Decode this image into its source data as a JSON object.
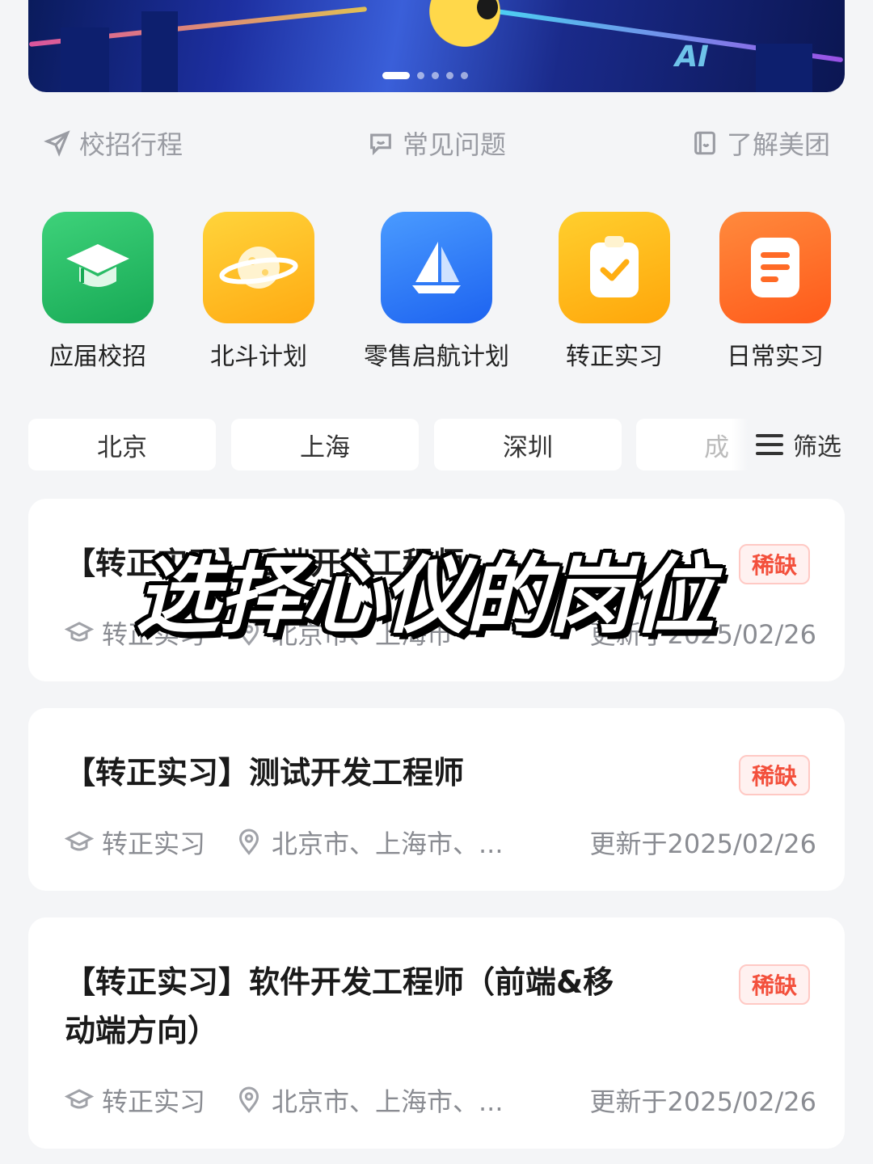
{
  "quick_links": [
    {
      "label": "校招行程",
      "icon": "send-icon"
    },
    {
      "label": "常见问题",
      "icon": "chat-icon"
    },
    {
      "label": "了解美团",
      "icon": "book-icon"
    }
  ],
  "categories": [
    {
      "label": "应届校招",
      "icon": "graduation-cap-icon",
      "color": "#22b862"
    },
    {
      "label": "北斗计划",
      "icon": "planet-icon",
      "color": "#ffbb1f"
    },
    {
      "label": "零售启航计划",
      "icon": "sailboat-icon",
      "color": "#2c76f5"
    },
    {
      "label": "转正实习",
      "icon": "clipboard-check-icon",
      "color": "#ffb81a"
    },
    {
      "label": "日常实习",
      "icon": "document-icon",
      "color": "#ff6a26"
    }
  ],
  "city_tabs": [
    "北京",
    "上海",
    "深圳",
    "成"
  ],
  "filter": {
    "label": "筛选",
    "icon": "menu-icon"
  },
  "overlay_caption": "选择心仪的岗位",
  "jobs": [
    {
      "title": "【转正实习】后端开发工程师",
      "badge": "稀缺",
      "type": "转正实习",
      "locations": "北京市、上海市",
      "updated": "更新于2025/02/26"
    },
    {
      "title": "【转正实习】测试开发工程师",
      "badge": "稀缺",
      "type": "转正实习",
      "locations": "北京市、上海市、...",
      "updated": "更新于2025/02/26"
    },
    {
      "title": "【转正实习】软件开发工程师（前端&移动端方向）",
      "badge": "稀缺",
      "type": "转正实习",
      "locations": "北京市、上海市、...",
      "updated": "更新于2025/02/26"
    }
  ],
  "colors": {
    "background": "#f4f5f7",
    "badge_text": "#f3503c",
    "badge_border": "#ffc9c4",
    "muted_text": "#8a8c92"
  }
}
